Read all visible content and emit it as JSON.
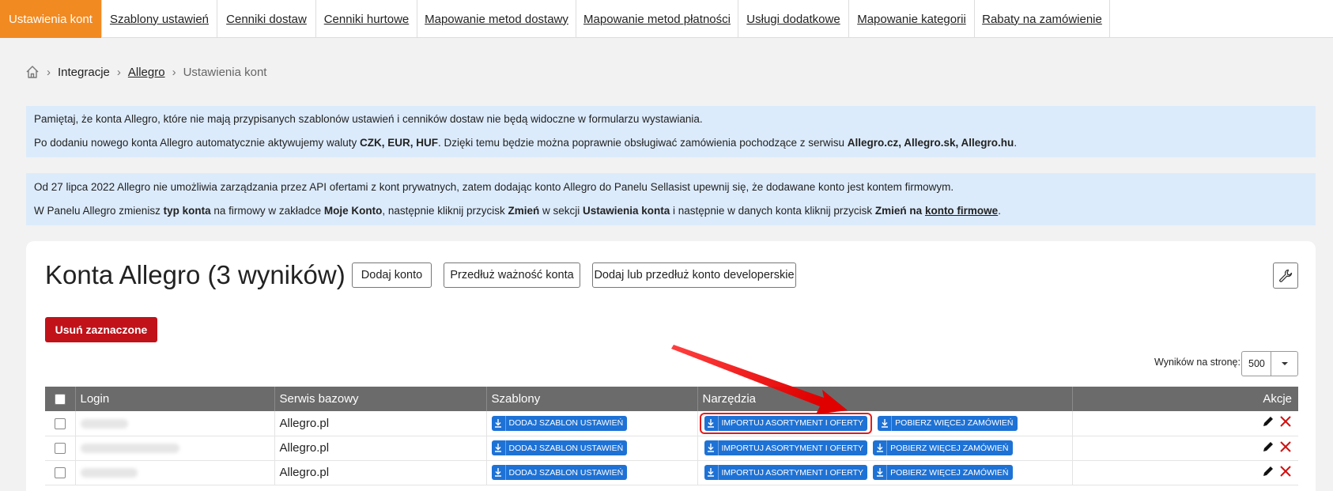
{
  "tabs": [
    {
      "label": "Ustawienia kont",
      "active": true
    },
    {
      "label": "Szablony ustawień"
    },
    {
      "label": "Cenniki dostaw"
    },
    {
      "label": "Cenniki hurtowe"
    },
    {
      "label": "Mapowanie metod dostawy"
    },
    {
      "label": "Mapowanie metod płatności"
    },
    {
      "label": "Usługi dodatkowe"
    },
    {
      "label": "Mapowanie kategorii"
    },
    {
      "label": "Rabaty na zamówienie"
    }
  ],
  "breadcrumb": {
    "home_icon": "home-icon",
    "items": [
      "Integracje",
      "Allegro",
      "Ustawienia kont"
    ]
  },
  "info1": {
    "line1": "Pamiętaj, że konta Allegro, które nie mają przypisanych szablonów ustawień i cenników dostaw nie będą widoczne w formularzu wystawiania.",
    "line2_a": "Po dodaniu nowego konta Allegro automatycznie aktywujemy waluty ",
    "line2_b": "CZK, EUR, HUF",
    "line2_c": ". Dzięki temu będzie można poprawnie obsługiwać zamówienia pochodzące z serwisu ",
    "line2_d": "Allegro.cz, Allegro.sk, Allegro.hu",
    "line2_e": "."
  },
  "info2": {
    "line1": "Od 27 lipca 2022 Allegro nie umożliwia zarządzania przez API ofertami z kont prywatnych, zatem dodając konto Allegro do Panelu Sellasist upewnij się, że dodawane konto jest kontem firmowym.",
    "l2_1": "W Panelu Allegro zmienisz ",
    "l2_2": "typ konta",
    "l2_3": " na firmowy w zakładce ",
    "l2_4": "Moje Konto",
    "l2_5": ", następnie kliknij przycisk ",
    "l2_6": "Zmień",
    "l2_7": " w sekcji ",
    "l2_8": "Ustawienia konta",
    "l2_9": " i następnie w danych konta kliknij przycisk ",
    "l2_10": "Zmień na",
    "l2_11": " ",
    "l2_12": "konto firmowe",
    "l2_13": "."
  },
  "panel": {
    "title": "Konta Allegro (3 wyników)",
    "add_account": "Dodaj konto",
    "extend_account": "Przedłuż ważność konta",
    "add_dev_account": "Dodaj lub przedłuż konto developerskie",
    "settings_icon": "wrench-icon",
    "delete_selected": "Usuń zaznaczone",
    "per_page_label": "Wyników na stronę:",
    "per_page_value": "500"
  },
  "table": {
    "headers": [
      "Login",
      "Serwis bazowy",
      "Szablony",
      "Narzędzia",
      "Akcje"
    ],
    "rows": [
      {
        "service": "Allegro.pl",
        "template_btn": "DODAJ SZABLON USTAWIEŃ",
        "import_btn": "IMPORTUJ ASORTYMENT I OFERTY",
        "orders_btn": "POBIERZ WIĘCEJ ZAMÓWIEŃ",
        "highlighted": true
      },
      {
        "service": "Allegro.pl",
        "template_btn": "DODAJ SZABLON USTAWIEŃ",
        "import_btn": "IMPORTUJ ASORTYMENT I OFERTY",
        "orders_btn": "POBIERZ WIĘCEJ ZAMÓWIEŃ",
        "highlighted": false
      },
      {
        "service": "Allegro.pl",
        "template_btn": "DODAJ SZABLON USTAWIEŃ",
        "import_btn": "IMPORTUJ ASORTYMENT I OFERTY",
        "orders_btn": "POBIERZ WIĘCEJ ZAMÓWIEŃ",
        "highlighted": false
      }
    ]
  },
  "colors": {
    "accent": "#f28a22",
    "primary_button": "#1e72d6",
    "danger": "#c1121a",
    "annotation": "#e61b1b"
  }
}
